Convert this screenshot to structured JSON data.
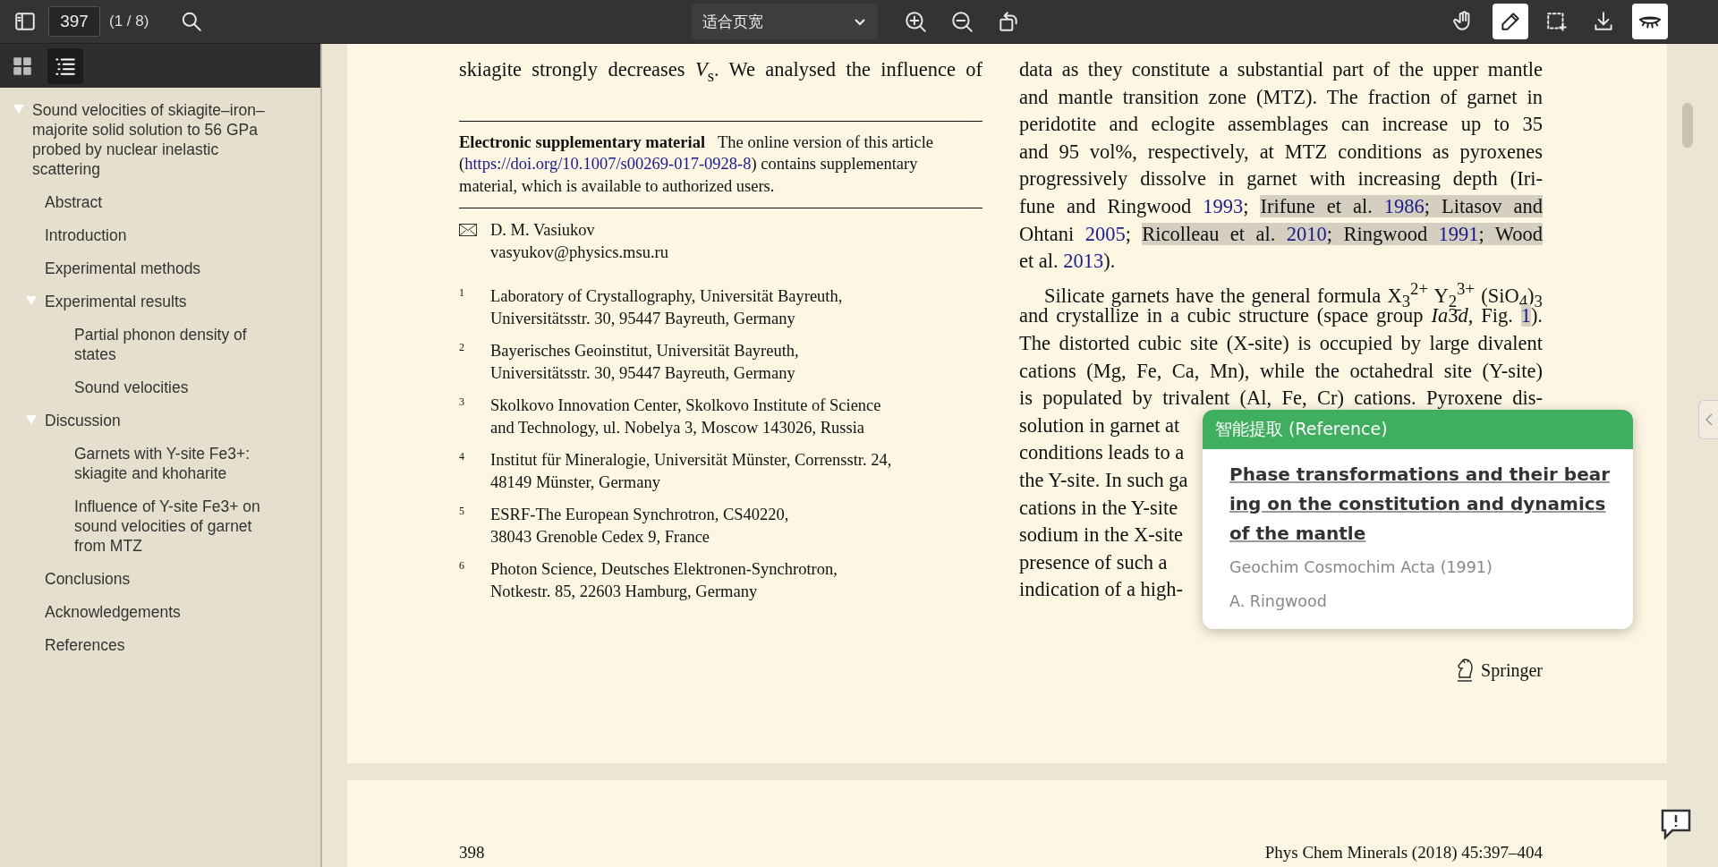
{
  "toolbar": {
    "page_number": "397",
    "page_count": "(1 / 8)",
    "zoom_mode": "适合页宽",
    "tools": [
      {
        "kind": "hand",
        "selected": false
      },
      {
        "kind": "pen",
        "selected": true
      },
      {
        "kind": "area",
        "selected": false
      }
    ],
    "night_mode": {
      "on": true
    }
  },
  "sidebar": {
    "tabs": [
      {
        "kind": "thumbnails",
        "selected": false
      },
      {
        "kind": "outline",
        "selected": true
      }
    ],
    "outline": [
      {
        "label": "Sound velocities of skiagite–iron–majorite solid solution to 56 GPa probed by nuclear inelastic scattering",
        "expanded": true,
        "children": [
          {
            "label": "Abstract"
          },
          {
            "label": "Introduction"
          },
          {
            "label": "Experimental methods"
          },
          {
            "label": "Experimental results",
            "expanded": true,
            "children": [
              {
                "label": "Partial phonon density of states"
              },
              {
                "label": "Sound velocities"
              }
            ]
          },
          {
            "label": "Discussion",
            "expanded": true,
            "children": [
              {
                "label": "Garnets with Y-site Fe3+: skiagite and khoharite"
              },
              {
                "label": "Influence of Y-site Fe3+ on sound velocities of garnet from MTZ"
              }
            ]
          },
          {
            "label": "Conclusions"
          },
          {
            "label": "Acknowledgements"
          },
          {
            "label": "References"
          }
        ]
      }
    ]
  },
  "page": {
    "left_column": {
      "text_lines": [
        "skiagite strongly decreases *V*$_{s}$. We analysed the influence of"
      ],
      "supplementary": {
        "lead": "Electronic supplementary material",
        "before": "The online version of this article (",
        "link": "https://doi.org/10.1007/s00269-017-0928-8",
        "after": ") contains supplementary material, which is available to authorized users."
      },
      "author": {
        "name": "D. M. Vasiukov",
        "email": "vasyukov@physics.msu.ru"
      },
      "affiliations": [
        {
          "number": "1",
          "lines": [
            "Laboratory of Crystallography, Universität Bayreuth,",
            "Universitätsstr. 30, 95447 Bayreuth, Germany"
          ]
        },
        {
          "number": "2",
          "lines": [
            "Bayerisches Geoinstitut, Universität Bayreuth,",
            "Universitätsstr. 30, 95447 Bayreuth, Germany"
          ]
        },
        {
          "number": "3",
          "lines": [
            "Skolkovo Innovation Center, Skolkovo Institute of Science",
            "and Technology, ul. Nobelya 3, Moscow 143026, Russia"
          ]
        },
        {
          "number": "4",
          "lines": [
            "Institut für Mineralogie, Universität Münster, Corrensstr. 24,",
            "48149 Münster, Germany"
          ]
        },
        {
          "number": "5",
          "lines": [
            "ESRF-The European Synchrotron, CS40220,",
            "38043 Grenoble Cedex 9, France"
          ]
        },
        {
          "number": "6",
          "lines": [
            "Photon Science, Deutsches Elektronen-Synchrotron,",
            "Notkestr. 85, 22603 Hamburg, Germany"
          ]
        }
      ]
    },
    "right_column": {
      "lines": [
        {
          "kind": "full",
          "text": "data as they constitute a substantial part of the upper mantle"
        },
        {
          "kind": "full",
          "text": "and mantle transition zone (MTZ). The fraction of garnet in"
        },
        {
          "kind": "full",
          "text": "peridotite and eclogite assemblages can increase up to 35"
        },
        {
          "kind": "full",
          "text": "and 95 vol%, respectively, at MTZ conditions as pyroxenes"
        },
        {
          "kind": "full",
          "text": "progressively dissolve in garnet with increasing depth (Iri-"
        },
        {
          "kind": "full",
          "segments": [
            {
              "kind": "plain",
              "text": "fune and Ringwood "
            },
            {
              "kind": "cite",
              "text": "1993"
            },
            {
              "kind": "plain",
              "text": "; "
            },
            {
              "kind": "marked",
              "text": "Irifune et al. "
            },
            {
              "kind": "marked_cite",
              "text": "1986"
            },
            {
              "kind": "marked",
              "text": "; "
            },
            {
              "kind": "marked",
              "text": "Litasov and"
            }
          ]
        },
        {
          "kind": "full",
          "segments": [
            {
              "kind": "plain",
              "text": "Ohtani "
            },
            {
              "kind": "cite",
              "text": "2005"
            },
            {
              "kind": "plain",
              "text": "; "
            },
            {
              "kind": "marked",
              "text": "Ricolleau et al. "
            },
            {
              "kind": "marked_cite",
              "text": "2010"
            },
            {
              "kind": "marked",
              "text": "; "
            },
            {
              "kind": "marked",
              "text": "Ringwood "
            },
            {
              "kind": "marked_cite",
              "text": "1991"
            },
            {
              "kind": "marked",
              "text": "; "
            },
            {
              "kind": "marked",
              "text": "Wood"
            }
          ]
        },
        {
          "kind": "end",
          "segments": [
            {
              "kind": "plain",
              "text": "et al. "
            },
            {
              "kind": "cite",
              "text": "2013"
            },
            {
              "kind": "plain",
              "text": ")."
            }
          ]
        },
        {
          "kind": "first",
          "text": "Silicate garnets have the general formula X$_{3}$$^{2+}$ Y$_{2}$$^{3+}$ (SiO$_{4}$)$_{3}$"
        },
        {
          "kind": "full",
          "segments": [
            {
              "kind": "plain",
              "text": "and crystallize in a cubic structure (space group "
            },
            {
              "kind": "italic",
              "text": "Ia"
            },
            {
              "kind": "plain",
              "text": "3̄"
            },
            {
              "kind": "italic",
              "text": "d"
            },
            {
              "kind": "plain",
              "text": ", Fig. "
            },
            {
              "kind": "marked_cite",
              "text": "1"
            },
            {
              "kind": "plain",
              "text": ")."
            }
          ]
        },
        {
          "kind": "full",
          "text": "The distorted cubic site (X-site) is occupied by large divalent"
        },
        {
          "kind": "full",
          "text": "cations (Mg, Fe, Ca, Mn), while the octahedral site (Y-site)"
        },
        {
          "kind": "full",
          "text": "is populated by trivalent (Al, Fe, Cr) cations. Pyroxene dis-"
        },
        {
          "kind": "cut",
          "text": "solution in garnet at"
        },
        {
          "kind": "cut",
          "text": "conditions leads to a"
        },
        {
          "kind": "cut",
          "text": "the Y-site. In such ga"
        },
        {
          "kind": "cut",
          "text": "cations in the Y-site"
        },
        {
          "kind": "cut",
          "text": "sodium in the X-site"
        },
        {
          "kind": "cut",
          "text": "presence of such a"
        },
        {
          "kind": "cut",
          "text": "indication of a high-"
        }
      ]
    },
    "footer": {
      "publisher": "Springer"
    }
  },
  "next_page": {
    "page_number": "398",
    "running_head": "Phys Chem Minerals (2018) 45:397–404"
  },
  "reference_popup": {
    "header": "智能提取 (Reference)",
    "title": "Phase transformations and their bearing on the constitution and dynamics of the mantle",
    "journal": "Geochim Cosmochim Acta (1991)",
    "author": "A. Ringwood"
  }
}
